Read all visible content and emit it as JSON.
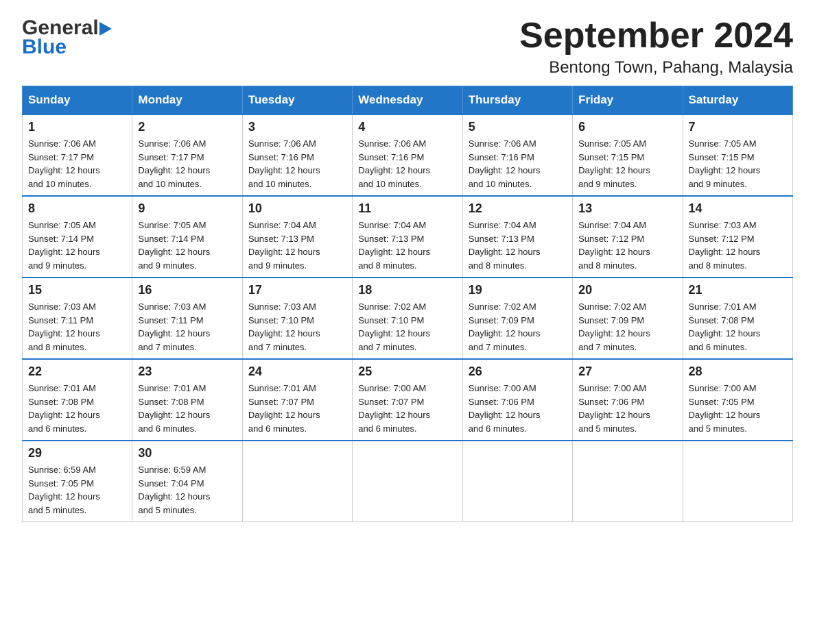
{
  "logo": {
    "general": "General",
    "blue": "Blue"
  },
  "title": "September 2024",
  "subtitle": "Bentong Town, Pahang, Malaysia",
  "days_of_week": [
    "Sunday",
    "Monday",
    "Tuesday",
    "Wednesday",
    "Thursday",
    "Friday",
    "Saturday"
  ],
  "weeks": [
    [
      {
        "day": "1",
        "sunrise": "7:06 AM",
        "sunset": "7:17 PM",
        "daylight": "12 hours and 10 minutes."
      },
      {
        "day": "2",
        "sunrise": "7:06 AM",
        "sunset": "7:17 PM",
        "daylight": "12 hours and 10 minutes."
      },
      {
        "day": "3",
        "sunrise": "7:06 AM",
        "sunset": "7:16 PM",
        "daylight": "12 hours and 10 minutes."
      },
      {
        "day": "4",
        "sunrise": "7:06 AM",
        "sunset": "7:16 PM",
        "daylight": "12 hours and 10 minutes."
      },
      {
        "day": "5",
        "sunrise": "7:06 AM",
        "sunset": "7:16 PM",
        "daylight": "12 hours and 10 minutes."
      },
      {
        "day": "6",
        "sunrise": "7:05 AM",
        "sunset": "7:15 PM",
        "daylight": "12 hours and 9 minutes."
      },
      {
        "day": "7",
        "sunrise": "7:05 AM",
        "sunset": "7:15 PM",
        "daylight": "12 hours and 9 minutes."
      }
    ],
    [
      {
        "day": "8",
        "sunrise": "7:05 AM",
        "sunset": "7:14 PM",
        "daylight": "12 hours and 9 minutes."
      },
      {
        "day": "9",
        "sunrise": "7:05 AM",
        "sunset": "7:14 PM",
        "daylight": "12 hours and 9 minutes."
      },
      {
        "day": "10",
        "sunrise": "7:04 AM",
        "sunset": "7:13 PM",
        "daylight": "12 hours and 9 minutes."
      },
      {
        "day": "11",
        "sunrise": "7:04 AM",
        "sunset": "7:13 PM",
        "daylight": "12 hours and 8 minutes."
      },
      {
        "day": "12",
        "sunrise": "7:04 AM",
        "sunset": "7:13 PM",
        "daylight": "12 hours and 8 minutes."
      },
      {
        "day": "13",
        "sunrise": "7:04 AM",
        "sunset": "7:12 PM",
        "daylight": "12 hours and 8 minutes."
      },
      {
        "day": "14",
        "sunrise": "7:03 AM",
        "sunset": "7:12 PM",
        "daylight": "12 hours and 8 minutes."
      }
    ],
    [
      {
        "day": "15",
        "sunrise": "7:03 AM",
        "sunset": "7:11 PM",
        "daylight": "12 hours and 8 minutes."
      },
      {
        "day": "16",
        "sunrise": "7:03 AM",
        "sunset": "7:11 PM",
        "daylight": "12 hours and 7 minutes."
      },
      {
        "day": "17",
        "sunrise": "7:03 AM",
        "sunset": "7:10 PM",
        "daylight": "12 hours and 7 minutes."
      },
      {
        "day": "18",
        "sunrise": "7:02 AM",
        "sunset": "7:10 PM",
        "daylight": "12 hours and 7 minutes."
      },
      {
        "day": "19",
        "sunrise": "7:02 AM",
        "sunset": "7:09 PM",
        "daylight": "12 hours and 7 minutes."
      },
      {
        "day": "20",
        "sunrise": "7:02 AM",
        "sunset": "7:09 PM",
        "daylight": "12 hours and 7 minutes."
      },
      {
        "day": "21",
        "sunrise": "7:01 AM",
        "sunset": "7:08 PM",
        "daylight": "12 hours and 6 minutes."
      }
    ],
    [
      {
        "day": "22",
        "sunrise": "7:01 AM",
        "sunset": "7:08 PM",
        "daylight": "12 hours and 6 minutes."
      },
      {
        "day": "23",
        "sunrise": "7:01 AM",
        "sunset": "7:08 PM",
        "daylight": "12 hours and 6 minutes."
      },
      {
        "day": "24",
        "sunrise": "7:01 AM",
        "sunset": "7:07 PM",
        "daylight": "12 hours and 6 minutes."
      },
      {
        "day": "25",
        "sunrise": "7:00 AM",
        "sunset": "7:07 PM",
        "daylight": "12 hours and 6 minutes."
      },
      {
        "day": "26",
        "sunrise": "7:00 AM",
        "sunset": "7:06 PM",
        "daylight": "12 hours and 6 minutes."
      },
      {
        "day": "27",
        "sunrise": "7:00 AM",
        "sunset": "7:06 PM",
        "daylight": "12 hours and 5 minutes."
      },
      {
        "day": "28",
        "sunrise": "7:00 AM",
        "sunset": "7:05 PM",
        "daylight": "12 hours and 5 minutes."
      }
    ],
    [
      {
        "day": "29",
        "sunrise": "6:59 AM",
        "sunset": "7:05 PM",
        "daylight": "12 hours and 5 minutes."
      },
      {
        "day": "30",
        "sunrise": "6:59 AM",
        "sunset": "7:04 PM",
        "daylight": "12 hours and 5 minutes."
      },
      null,
      null,
      null,
      null,
      null
    ]
  ]
}
